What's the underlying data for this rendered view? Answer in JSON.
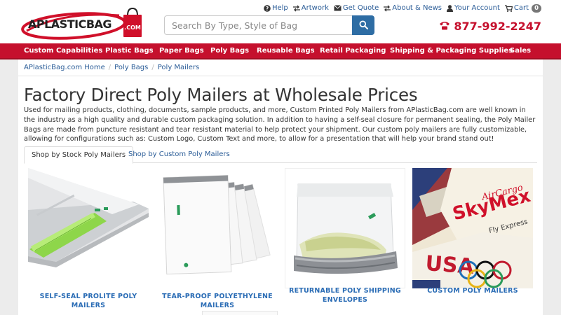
{
  "header": {
    "logo_text": "APLASTICBAG.COM",
    "search_placeholder": "Search By Type, Style of Bag",
    "phone": "877-992-2247",
    "top_links": [
      {
        "label": "Help",
        "icon": "question-circle-icon"
      },
      {
        "label": "Artwork",
        "icon": "swap-arrows-icon"
      },
      {
        "label": "Get Quote",
        "icon": "envelope-icon"
      },
      {
        "label": "About & News",
        "icon": "swap-arrows-icon"
      },
      {
        "label": "Your Account",
        "icon": "user-icon"
      },
      {
        "label": "Cart",
        "icon": "cart-icon",
        "badge": "0"
      }
    ]
  },
  "nav": {
    "items": [
      {
        "label": "Custom Capabilities"
      },
      {
        "label": "Plastic Bags"
      },
      {
        "label": "Paper Bags"
      },
      {
        "label": "Poly Bags"
      },
      {
        "label": "Reusable Bags"
      },
      {
        "label": "Retail Packaging"
      },
      {
        "label": "Shipping & Packaging Supplies"
      },
      {
        "label": "Sales"
      }
    ]
  },
  "breadcrumb": {
    "items": [
      "APlasticBag.com Home",
      "Poly Bags",
      "Poly Mailers"
    ],
    "separator": "/"
  },
  "main": {
    "title": "Factory Direct Poly Mailers at Wholesale Prices",
    "description": "Used for mailing products, clothing, documents, sample products, and more, Custom Printed Poly Mailers from APlasticBag.com are well known in the industry as a high quality and durable custom packaging solution. In addition to having a self-seal closure for permanent sealing, the Poly Mailer Bags are made from puncture resistant and tear resistant material to help protect your shipment. Our custom poly mailers are fully customizable, allowing for configurations such as: Custom Logo, Custom Text and more, to allow for a presentation that will help your brand stand out!",
    "tabs": [
      {
        "label": "Shop by Stock Poly Mailers",
        "active": true
      },
      {
        "label": "Shop by Custom Poly Mailers",
        "active": false
      }
    ]
  },
  "products": [
    {
      "name": "SELF-SEAL PROLITE POLY MAILERS"
    },
    {
      "name": "TEAR-PROOF POLYETHYLENE MAILERS"
    },
    {
      "name": "RETURNABLE POLY SHIPPING ENVELOPES"
    },
    {
      "name": "CUSTOM POLY MAILERS"
    }
  ],
  "custom_mailer_print": {
    "brand": "SkyMex",
    "subbrand": "AirCargo",
    "tagline": "Fly Express",
    "country": "USA"
  },
  "colors": {
    "brand_red": "#c5102d",
    "link_blue": "#2a5c97",
    "product_blue": "#2a6cb5",
    "search_button": "#2e6da4",
    "page_bg": "#ececec"
  }
}
